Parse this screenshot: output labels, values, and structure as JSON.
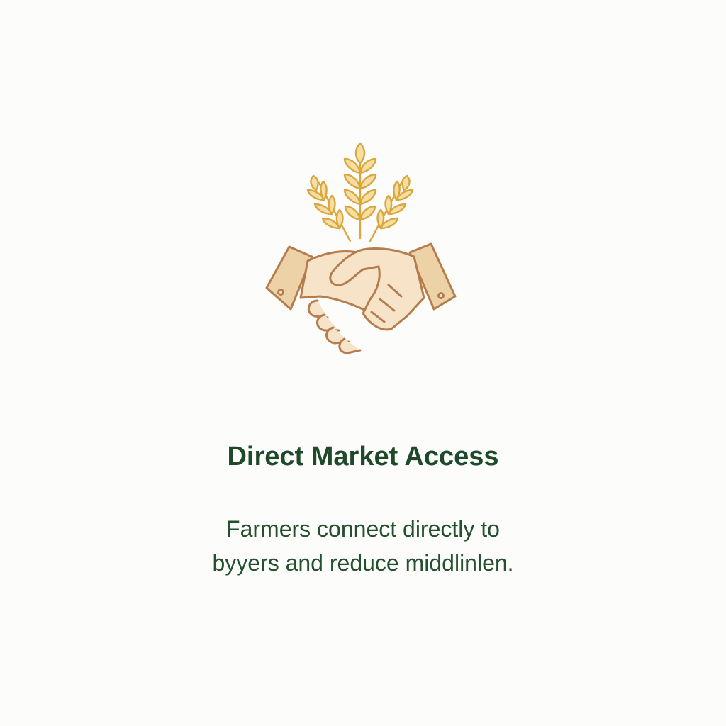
{
  "card": {
    "icon": "handshake-wheat-icon",
    "title": "Direct Market Access",
    "description_lines": [
      "Farmers connect directly to",
      "byyers and reduce middlinlen."
    ]
  },
  "colors": {
    "background": "#fcfcfb",
    "title": "#1e4a2a",
    "description": "#25502f",
    "wheat": "#e0b24f",
    "skin": "#f6e3c8",
    "cuff": "#ecd2a6",
    "outline": "#b57d4e"
  }
}
